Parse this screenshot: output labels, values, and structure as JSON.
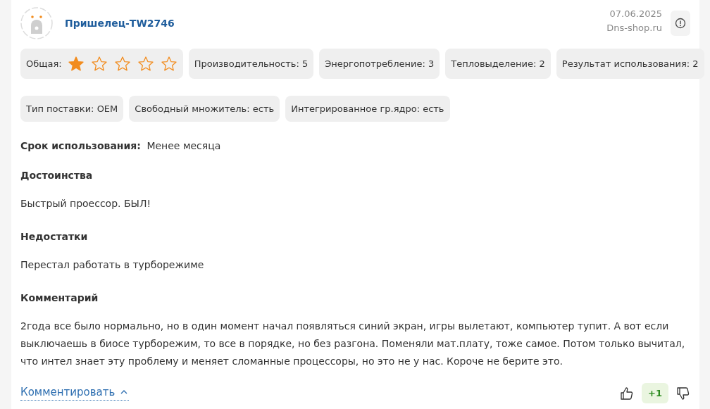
{
  "review": {
    "author": "Пришелец-TW2746",
    "date": "07.06.2025",
    "source": "Dns-shop.ru",
    "rating": {
      "label": "Общая:",
      "stars": 1
    },
    "scores": [
      {
        "label": "Производительность:",
        "value": "5"
      },
      {
        "label": "Энергопотребление:",
        "value": "3"
      },
      {
        "label": "Тепловыделение:",
        "value": "2"
      },
      {
        "label": "Результат использования:",
        "value": "2"
      }
    ],
    "specs": [
      {
        "label": "Тип поставки:",
        "value": "OEM"
      },
      {
        "label": "Свободный множитель:",
        "value": "есть"
      },
      {
        "label": "Интегрированное гр.ядро:",
        "value": "есть"
      }
    ],
    "usage": {
      "label": "Срок использования:",
      "value": "Менее месяца"
    },
    "sections": [
      {
        "title": "Достоинства",
        "text": "Быстрый проессор. БЫЛ!"
      },
      {
        "title": "Недостатки",
        "text": "Перестал работать в турборежиме"
      },
      {
        "title": "Комментарий",
        "text": "2года все было нормально, но в один момент начал появляться синий экран, игры вылетают, компьютер тупит. А вот если выключаешь в биосе турборежим, то все в порядке, но без разгона. Поменяли мат.плату, тоже самое. Потом только вычитал, что интел знает эту проблему и меняет сломанные процессоры, но это не у нас. Короче не берите это."
      }
    ],
    "comment_link": "Комментировать",
    "comments_expanded": true,
    "votes": "+1"
  }
}
